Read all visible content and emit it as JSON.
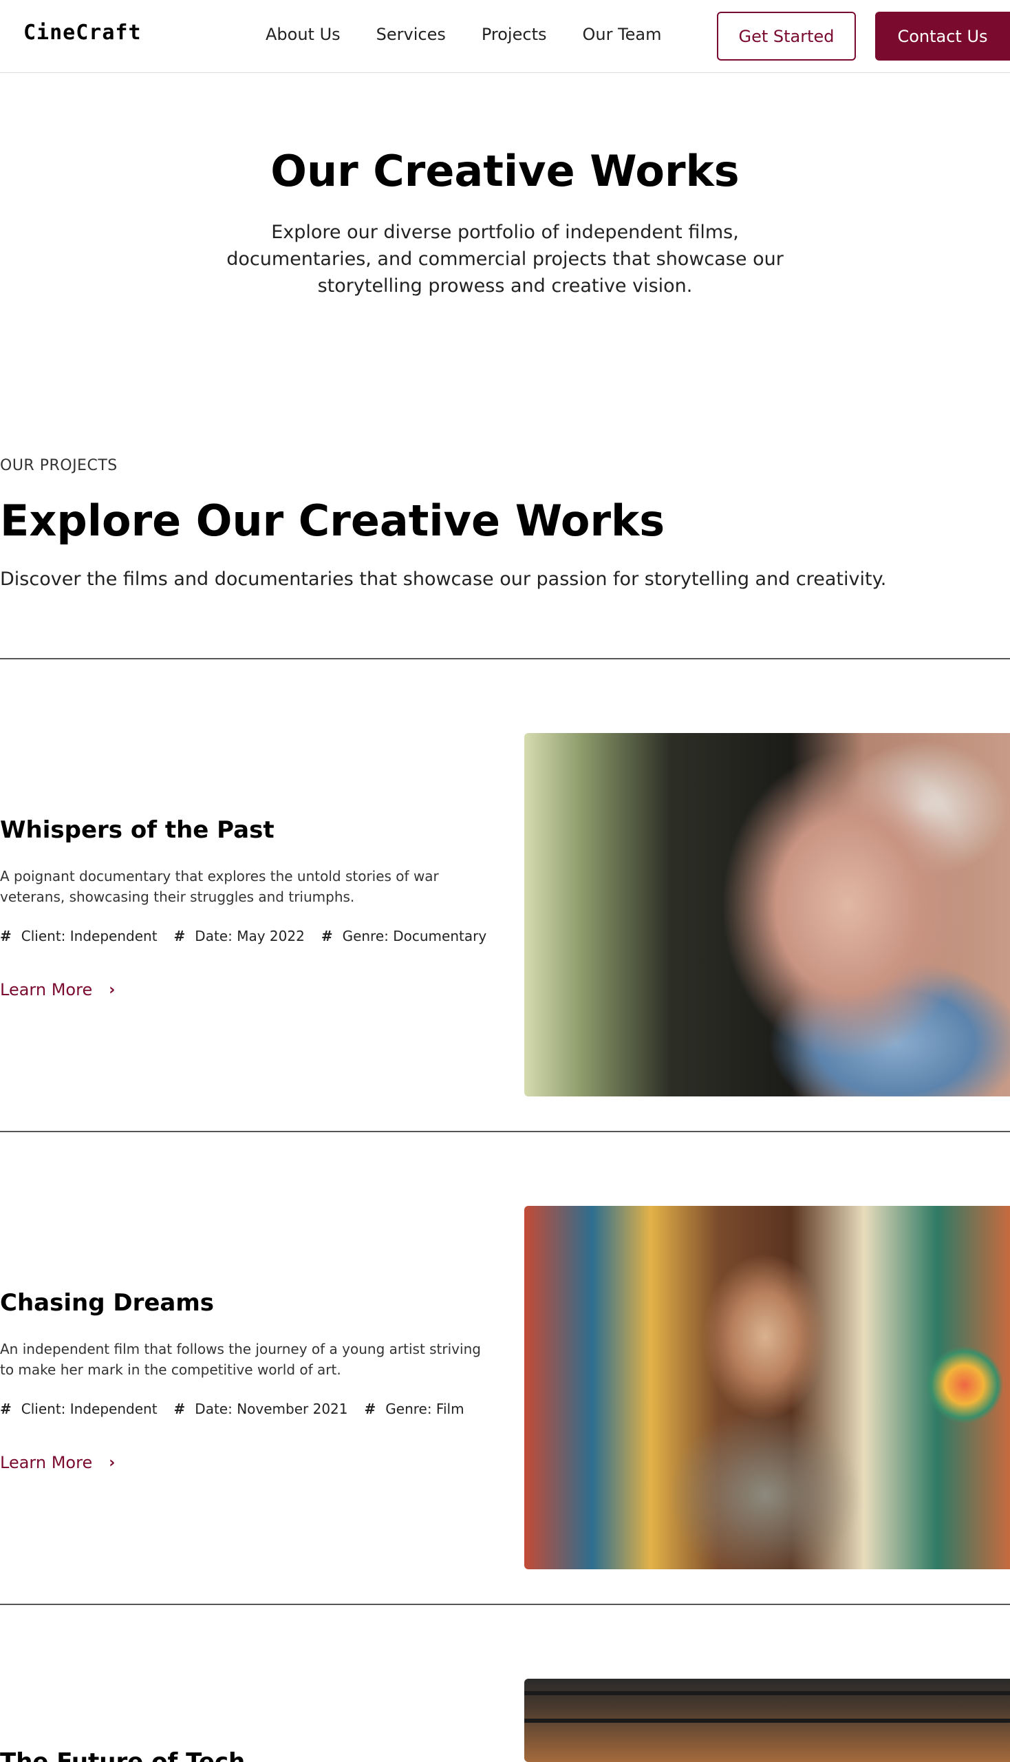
{
  "brand": {
    "logo": "CineCraft",
    "accent": "#7a0b2e"
  },
  "nav": {
    "items": [
      "About Us",
      "Services",
      "Projects",
      "Our Team"
    ]
  },
  "header_actions": {
    "get_started": "Get Started",
    "contact": "Contact Us"
  },
  "hero": {
    "title": "Our Creative Works",
    "subtitle": "Explore our diverse portfolio of independent films, documentaries, and commercial projects that showcase our storytelling prowess and creative vision."
  },
  "section": {
    "eyebrow": "OUR PROJECTS",
    "title": "Explore Our Creative Works",
    "subtitle": "Discover the films and documentaries that showcase our passion for storytelling and creativity."
  },
  "projects": [
    {
      "title": "Whispers of the Past",
      "description": "A poignant documentary that explores the untold stories of war veterans, showcasing their struggles and triumphs.",
      "client": "Client: Independent",
      "date": "Date: May 2022",
      "genre": "Genre: Documentary",
      "cta": "Learn More",
      "image": "elderly-veteran-portrait"
    },
    {
      "title": "Chasing Dreams",
      "description": "An independent film that follows the journey of a young artist striving to make her mark in the competitive world of art.",
      "client": "Client: Independent",
      "date": "Date: November 2021",
      "genre": "Genre: Film",
      "cta": "Learn More",
      "image": "young-artist-in-studio"
    },
    {
      "title": "The Future of Tech",
      "image": "industrial-workspace"
    }
  ],
  "icons": {
    "meta": "hash-icon",
    "cta": "chevron-right-icon"
  }
}
